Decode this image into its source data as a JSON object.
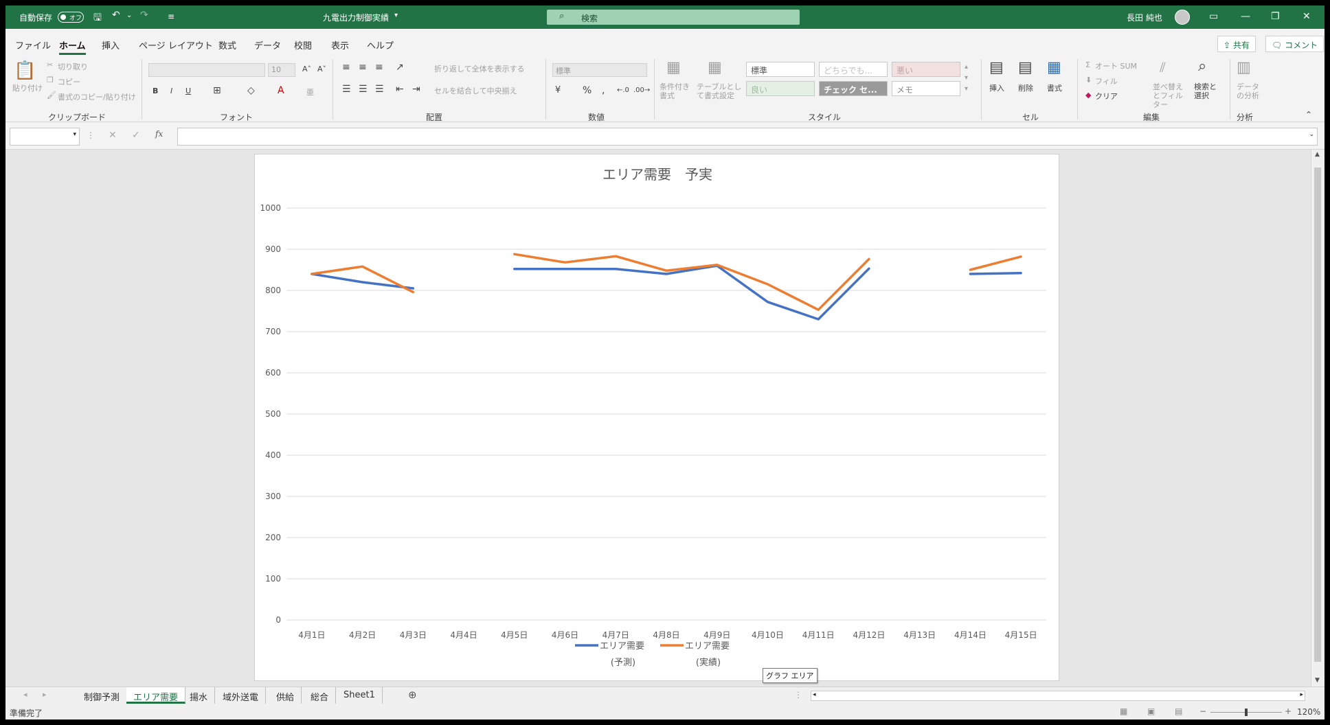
{
  "titlebar": {
    "autosave_label": "自動保存",
    "autosave_state": "オフ",
    "file_name": "九電出力制御実績",
    "search_placeholder": "検索",
    "user_name": "長田 純也"
  },
  "menu": {
    "tabs": [
      "ファイル",
      "ホーム",
      "挿入",
      "ページ レイアウト",
      "数式",
      "データ",
      "校閲",
      "表示",
      "ヘルプ"
    ],
    "active_tab": "ホーム",
    "share_label": "共有",
    "comment_label": "コメント"
  },
  "ribbon": {
    "clipboard": {
      "paste": "貼り付け",
      "cut": "切り取り",
      "copy": "コピー",
      "format_painter": "書式のコピー/貼り付け",
      "label": "クリップボード"
    },
    "font": {
      "size": "10",
      "bold": "B",
      "italic": "I",
      "underline": "U",
      "label": "フォント"
    },
    "alignment": {
      "wrap": "折り返して全体を表示する",
      "merge": "セルを結合して中央揃え",
      "label": "配置"
    },
    "number": {
      "format": "標準",
      "percent": "%",
      "label": "数値"
    },
    "styles": {
      "conditional": "条件付き書式",
      "table": "テーブルとして書式設定",
      "standard": "標準",
      "neutral": "どちらでも...",
      "bad": "悪い",
      "good": "良い",
      "check": "チェック セ...",
      "memo": "メモ",
      "label": "スタイル"
    },
    "cells": {
      "insert": "挿入",
      "delete": "削除",
      "format": "書式",
      "label": "セル"
    },
    "editing": {
      "autosum": "オート SUM",
      "fill": "フィル",
      "clear": "クリア",
      "sort": "並べ替えとフィルター",
      "find": "検索と選択",
      "label": "編集"
    },
    "analysis": {
      "data_analysis": "データの分析",
      "label": "分析"
    }
  },
  "chart_data": {
    "type": "line",
    "title": "エリア需要　予実",
    "categories": [
      "4月1日",
      "4月2日",
      "4月3日",
      "4月4日",
      "4月5日",
      "4月6日",
      "4月7日",
      "4月8日",
      "4月9日",
      "4月10日",
      "4月11日",
      "4月12日",
      "4月13日",
      "4月14日",
      "4月15日"
    ],
    "ylim": [
      0,
      1000
    ],
    "yticks": [
      0,
      100,
      200,
      300,
      400,
      500,
      600,
      700,
      800,
      900,
      1000
    ],
    "grid": true,
    "legend_position": "bottom",
    "series": [
      {
        "name": "エリア需要\n(予測)",
        "color": "#4472c4",
        "values": [
          840,
          820,
          805,
          null,
          852,
          852,
          852,
          840,
          860,
          772,
          730,
          853,
          null,
          840,
          842
        ]
      },
      {
        "name": "エリア需要\n(実績)",
        "color": "#ed7d31",
        "values": [
          840,
          858,
          796,
          null,
          888,
          868,
          883,
          848,
          862,
          815,
          753,
          876,
          null,
          850,
          882
        ]
      }
    ]
  },
  "tooltip": "グラフ エリア",
  "sheet_tabs": [
    "制御予測",
    "エリア需要",
    "揚水",
    "域外送電",
    "供給",
    "総合",
    "Sheet1"
  ],
  "active_sheet": "エリア需要",
  "status": {
    "ready": "準備完了",
    "zoom": "120%"
  }
}
